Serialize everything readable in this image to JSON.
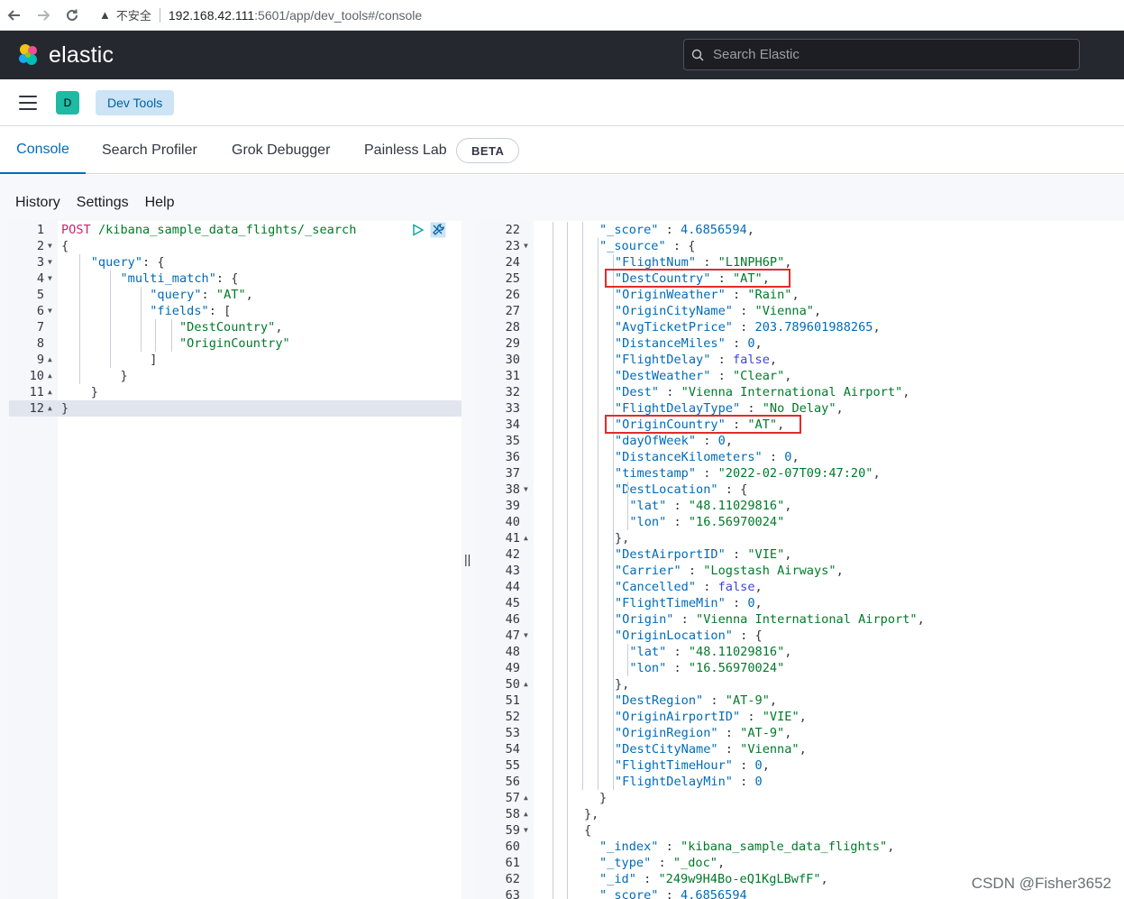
{
  "browser": {
    "security_label": "不安全",
    "url_host": "192.168.42.111",
    "url_path": ":5601/app/dev_tools#/console"
  },
  "header": {
    "logo_text": "elastic",
    "search_placeholder": "Search Elastic"
  },
  "breadcrumb": {
    "space_initial": "D",
    "current": "Dev Tools"
  },
  "tabs": [
    "Console",
    "Search Profiler",
    "Grok Debugger",
    "Painless Lab"
  ],
  "beta_badge": "BETA",
  "console_menu": [
    "History",
    "Settings",
    "Help"
  ],
  "request": {
    "lines": [
      {
        "num": "1",
        "fold": "",
        "tokens": [
          {
            "t": "k",
            "v": "POST"
          },
          {
            "t": "p",
            "v": " "
          },
          {
            "t": "s",
            "v": "/kibana_sample_data_flights/_search"
          }
        ]
      },
      {
        "num": "2",
        "fold": "▼",
        "tokens": [
          {
            "t": "p",
            "v": "{"
          }
        ]
      },
      {
        "num": "3",
        "fold": "▼",
        "tokens": [
          {
            "t": "p",
            "v": "    "
          },
          {
            "t": "key",
            "v": "\"query\""
          },
          {
            "t": "p",
            "v": ": {"
          }
        ]
      },
      {
        "num": "4",
        "fold": "▼",
        "tokens": [
          {
            "t": "p",
            "v": "        "
          },
          {
            "t": "key",
            "v": "\"multi_match\""
          },
          {
            "t": "p",
            "v": ": {"
          }
        ]
      },
      {
        "num": "5",
        "fold": "",
        "tokens": [
          {
            "t": "p",
            "v": "            "
          },
          {
            "t": "key",
            "v": "\"query\""
          },
          {
            "t": "p",
            "v": ": "
          },
          {
            "t": "s",
            "v": "\"AT\""
          },
          {
            "t": "p",
            "v": ","
          }
        ]
      },
      {
        "num": "6",
        "fold": "▼",
        "tokens": [
          {
            "t": "p",
            "v": "            "
          },
          {
            "t": "key",
            "v": "\"fields\""
          },
          {
            "t": "p",
            "v": ": ["
          }
        ]
      },
      {
        "num": "7",
        "fold": "",
        "tokens": [
          {
            "t": "p",
            "v": "                "
          },
          {
            "t": "s",
            "v": "\"DestCountry\""
          },
          {
            "t": "p",
            "v": ","
          }
        ]
      },
      {
        "num": "8",
        "fold": "",
        "tokens": [
          {
            "t": "p",
            "v": "                "
          },
          {
            "t": "s",
            "v": "\"OriginCountry\""
          }
        ]
      },
      {
        "num": "9",
        "fold": "▲",
        "tokens": [
          {
            "t": "p",
            "v": "            ]"
          }
        ]
      },
      {
        "num": "10",
        "fold": "▲",
        "tokens": [
          {
            "t": "p",
            "v": "        }"
          }
        ]
      },
      {
        "num": "11",
        "fold": "▲",
        "tokens": [
          {
            "t": "p",
            "v": "    }"
          }
        ]
      },
      {
        "num": "12",
        "fold": "▲",
        "tokens": [
          {
            "t": "p",
            "v": "}"
          }
        ]
      }
    ]
  },
  "response": {
    "lines": [
      {
        "num": "22",
        "fold": "",
        "tokens": [
          {
            "t": "key",
            "v": "\"_score\""
          },
          {
            "t": "p",
            "v": " : "
          },
          {
            "t": "n",
            "v": "4.6856594"
          },
          {
            "t": "p",
            "v": ","
          }
        ]
      },
      {
        "num": "23",
        "fold": "▼",
        "tokens": [
          {
            "t": "key",
            "v": "\"_source\""
          },
          {
            "t": "p",
            "v": " : {"
          }
        ]
      },
      {
        "num": "24",
        "fold": "",
        "tokens": [
          {
            "t": "key",
            "v": "\"FlightNum\""
          },
          {
            "t": "p",
            "v": " : "
          },
          {
            "t": "s",
            "v": "\"L1NPH6P\""
          },
          {
            "t": "p",
            "v": ","
          }
        ]
      },
      {
        "num": "25",
        "fold": "",
        "tokens": [
          {
            "t": "key",
            "v": "\"DestCountry\""
          },
          {
            "t": "p",
            "v": " : "
          },
          {
            "t": "s",
            "v": "\"AT\""
          },
          {
            "t": "p",
            "v": ","
          }
        ]
      },
      {
        "num": "26",
        "fold": "",
        "tokens": [
          {
            "t": "key",
            "v": "\"OriginWeather\""
          },
          {
            "t": "p",
            "v": " : "
          },
          {
            "t": "s",
            "v": "\"Rain\""
          },
          {
            "t": "p",
            "v": ","
          }
        ]
      },
      {
        "num": "27",
        "fold": "",
        "tokens": [
          {
            "t": "key",
            "v": "\"OriginCityName\""
          },
          {
            "t": "p",
            "v": " : "
          },
          {
            "t": "s",
            "v": "\"Vienna\""
          },
          {
            "t": "p",
            "v": ","
          }
        ]
      },
      {
        "num": "28",
        "fold": "",
        "tokens": [
          {
            "t": "key",
            "v": "\"AvgTicketPrice\""
          },
          {
            "t": "p",
            "v": " : "
          },
          {
            "t": "n",
            "v": "203.789601988265"
          },
          {
            "t": "p",
            "v": ","
          }
        ]
      },
      {
        "num": "29",
        "fold": "",
        "tokens": [
          {
            "t": "key",
            "v": "\"DistanceMiles\""
          },
          {
            "t": "p",
            "v": " : "
          },
          {
            "t": "n",
            "v": "0"
          },
          {
            "t": "p",
            "v": ","
          }
        ]
      },
      {
        "num": "30",
        "fold": "",
        "tokens": [
          {
            "t": "key",
            "v": "\"FlightDelay\""
          },
          {
            "t": "p",
            "v": " : "
          },
          {
            "t": "b",
            "v": "false"
          },
          {
            "t": "p",
            "v": ","
          }
        ]
      },
      {
        "num": "31",
        "fold": "",
        "tokens": [
          {
            "t": "key",
            "v": "\"DestWeather\""
          },
          {
            "t": "p",
            "v": " : "
          },
          {
            "t": "s",
            "v": "\"Clear\""
          },
          {
            "t": "p",
            "v": ","
          }
        ]
      },
      {
        "num": "32",
        "fold": "",
        "tokens": [
          {
            "t": "key",
            "v": "\"Dest\""
          },
          {
            "t": "p",
            "v": " : "
          },
          {
            "t": "s",
            "v": "\"Vienna International Airport\""
          },
          {
            "t": "p",
            "v": ","
          }
        ]
      },
      {
        "num": "33",
        "fold": "",
        "tokens": [
          {
            "t": "key",
            "v": "\"FlightDelayType\""
          },
          {
            "t": "p",
            "v": " : "
          },
          {
            "t": "s",
            "v": "\"No Delay\""
          },
          {
            "t": "p",
            "v": ","
          }
        ]
      },
      {
        "num": "34",
        "fold": "",
        "tokens": [
          {
            "t": "key",
            "v": "\"OriginCountry\""
          },
          {
            "t": "p",
            "v": " : "
          },
          {
            "t": "s",
            "v": "\"AT\""
          },
          {
            "t": "p",
            "v": ","
          }
        ]
      },
      {
        "num": "35",
        "fold": "",
        "tokens": [
          {
            "t": "key",
            "v": "\"dayOfWeek\""
          },
          {
            "t": "p",
            "v": " : "
          },
          {
            "t": "n",
            "v": "0"
          },
          {
            "t": "p",
            "v": ","
          }
        ]
      },
      {
        "num": "36",
        "fold": "",
        "tokens": [
          {
            "t": "key",
            "v": "\"DistanceKilometers\""
          },
          {
            "t": "p",
            "v": " : "
          },
          {
            "t": "n",
            "v": "0"
          },
          {
            "t": "p",
            "v": ","
          }
        ]
      },
      {
        "num": "37",
        "fold": "",
        "tokens": [
          {
            "t": "key",
            "v": "\"timestamp\""
          },
          {
            "t": "p",
            "v": " : "
          },
          {
            "t": "s",
            "v": "\"2022-02-07T09:47:20\""
          },
          {
            "t": "p",
            "v": ","
          }
        ]
      },
      {
        "num": "38",
        "fold": "▼",
        "tokens": [
          {
            "t": "key",
            "v": "\"DestLocation\""
          },
          {
            "t": "p",
            "v": " : {"
          }
        ]
      },
      {
        "num": "39",
        "fold": "",
        "tokens": [
          {
            "t": "p",
            "v": "  "
          },
          {
            "t": "key",
            "v": "\"lat\""
          },
          {
            "t": "p",
            "v": " : "
          },
          {
            "t": "s",
            "v": "\"48.11029816\""
          },
          {
            "t": "p",
            "v": ","
          }
        ]
      },
      {
        "num": "40",
        "fold": "",
        "tokens": [
          {
            "t": "p",
            "v": "  "
          },
          {
            "t": "key",
            "v": "\"lon\""
          },
          {
            "t": "p",
            "v": " : "
          },
          {
            "t": "s",
            "v": "\"16.56970024\""
          }
        ]
      },
      {
        "num": "41",
        "fold": "▲",
        "tokens": [
          {
            "t": "p",
            "v": "},"
          }
        ]
      },
      {
        "num": "42",
        "fold": "",
        "tokens": [
          {
            "t": "key",
            "v": "\"DestAirportID\""
          },
          {
            "t": "p",
            "v": " : "
          },
          {
            "t": "s",
            "v": "\"VIE\""
          },
          {
            "t": "p",
            "v": ","
          }
        ]
      },
      {
        "num": "43",
        "fold": "",
        "tokens": [
          {
            "t": "key",
            "v": "\"Carrier\""
          },
          {
            "t": "p",
            "v": " : "
          },
          {
            "t": "s",
            "v": "\"Logstash Airways\""
          },
          {
            "t": "p",
            "v": ","
          }
        ]
      },
      {
        "num": "44",
        "fold": "",
        "tokens": [
          {
            "t": "key",
            "v": "\"Cancelled\""
          },
          {
            "t": "p",
            "v": " : "
          },
          {
            "t": "b",
            "v": "false"
          },
          {
            "t": "p",
            "v": ","
          }
        ]
      },
      {
        "num": "45",
        "fold": "",
        "tokens": [
          {
            "t": "key",
            "v": "\"FlightTimeMin\""
          },
          {
            "t": "p",
            "v": " : "
          },
          {
            "t": "n",
            "v": "0"
          },
          {
            "t": "p",
            "v": ","
          }
        ]
      },
      {
        "num": "46",
        "fold": "",
        "tokens": [
          {
            "t": "key",
            "v": "\"Origin\""
          },
          {
            "t": "p",
            "v": " : "
          },
          {
            "t": "s",
            "v": "\"Vienna International Airport\""
          },
          {
            "t": "p",
            "v": ","
          }
        ]
      },
      {
        "num": "47",
        "fold": "▼",
        "tokens": [
          {
            "t": "key",
            "v": "\"OriginLocation\""
          },
          {
            "t": "p",
            "v": " : {"
          }
        ]
      },
      {
        "num": "48",
        "fold": "",
        "tokens": [
          {
            "t": "p",
            "v": "  "
          },
          {
            "t": "key",
            "v": "\"lat\""
          },
          {
            "t": "p",
            "v": " : "
          },
          {
            "t": "s",
            "v": "\"48.11029816\""
          },
          {
            "t": "p",
            "v": ","
          }
        ]
      },
      {
        "num": "49",
        "fold": "",
        "tokens": [
          {
            "t": "p",
            "v": "  "
          },
          {
            "t": "key",
            "v": "\"lon\""
          },
          {
            "t": "p",
            "v": " : "
          },
          {
            "t": "s",
            "v": "\"16.56970024\""
          }
        ]
      },
      {
        "num": "50",
        "fold": "▲",
        "tokens": [
          {
            "t": "p",
            "v": "},"
          }
        ]
      },
      {
        "num": "51",
        "fold": "",
        "tokens": [
          {
            "t": "key",
            "v": "\"DestRegion\""
          },
          {
            "t": "p",
            "v": " : "
          },
          {
            "t": "s",
            "v": "\"AT-9\""
          },
          {
            "t": "p",
            "v": ","
          }
        ]
      },
      {
        "num": "52",
        "fold": "",
        "tokens": [
          {
            "t": "key",
            "v": "\"OriginAirportID\""
          },
          {
            "t": "p",
            "v": " : "
          },
          {
            "t": "s",
            "v": "\"VIE\""
          },
          {
            "t": "p",
            "v": ","
          }
        ]
      },
      {
        "num": "53",
        "fold": "",
        "tokens": [
          {
            "t": "key",
            "v": "\"OriginRegion\""
          },
          {
            "t": "p",
            "v": " : "
          },
          {
            "t": "s",
            "v": "\"AT-9\""
          },
          {
            "t": "p",
            "v": ","
          }
        ]
      },
      {
        "num": "54",
        "fold": "",
        "tokens": [
          {
            "t": "key",
            "v": "\"DestCityName\""
          },
          {
            "t": "p",
            "v": " : "
          },
          {
            "t": "s",
            "v": "\"Vienna\""
          },
          {
            "t": "p",
            "v": ","
          }
        ]
      },
      {
        "num": "55",
        "fold": "",
        "tokens": [
          {
            "t": "key",
            "v": "\"FlightTimeHour\""
          },
          {
            "t": "p",
            "v": " : "
          },
          {
            "t": "n",
            "v": "0"
          },
          {
            "t": "p",
            "v": ","
          }
        ]
      },
      {
        "num": "56",
        "fold": "",
        "tokens": [
          {
            "t": "key",
            "v": "\"FlightDelayMin\""
          },
          {
            "t": "p",
            "v": " : "
          },
          {
            "t": "n",
            "v": "0"
          }
        ]
      },
      {
        "num": "57",
        "fold": "▲",
        "tokens": [
          {
            "t": "p",
            "v": "}"
          }
        ]
      },
      {
        "num": "58",
        "fold": "▲",
        "tokens": [
          {
            "t": "p",
            "v": "},"
          }
        ]
      },
      {
        "num": "59",
        "fold": "▼",
        "tokens": [
          {
            "t": "p",
            "v": "{"
          }
        ]
      },
      {
        "num": "60",
        "fold": "",
        "tokens": [
          {
            "t": "key",
            "v": "\"_index\""
          },
          {
            "t": "p",
            "v": " : "
          },
          {
            "t": "s",
            "v": "\"kibana_sample_data_flights\""
          },
          {
            "t": "p",
            "v": ","
          }
        ]
      },
      {
        "num": "61",
        "fold": "",
        "tokens": [
          {
            "t": "key",
            "v": "\"_type\""
          },
          {
            "t": "p",
            "v": " : "
          },
          {
            "t": "s",
            "v": "\"_doc\""
          },
          {
            "t": "p",
            "v": ","
          }
        ]
      },
      {
        "num": "62",
        "fold": "",
        "tokens": [
          {
            "t": "key",
            "v": "\"_id\""
          },
          {
            "t": "p",
            "v": " : "
          },
          {
            "t": "s",
            "v": "\"249w9H4Bo-eQ1KgLBwfF\""
          },
          {
            "t": "p",
            "v": ","
          }
        ]
      },
      {
        "num": "63",
        "fold": "",
        "tokens": [
          {
            "t": "key",
            "v": "\"_score\""
          },
          {
            "t": "p",
            "v": " : "
          },
          {
            "t": "n",
            "v": "4.6856594"
          }
        ]
      }
    ]
  },
  "watermark": "CSDN @Fisher3652",
  "colors": {
    "header_bg": "#25282f",
    "accent": "#006bb8",
    "highlight_box": "#e22b2b"
  }
}
